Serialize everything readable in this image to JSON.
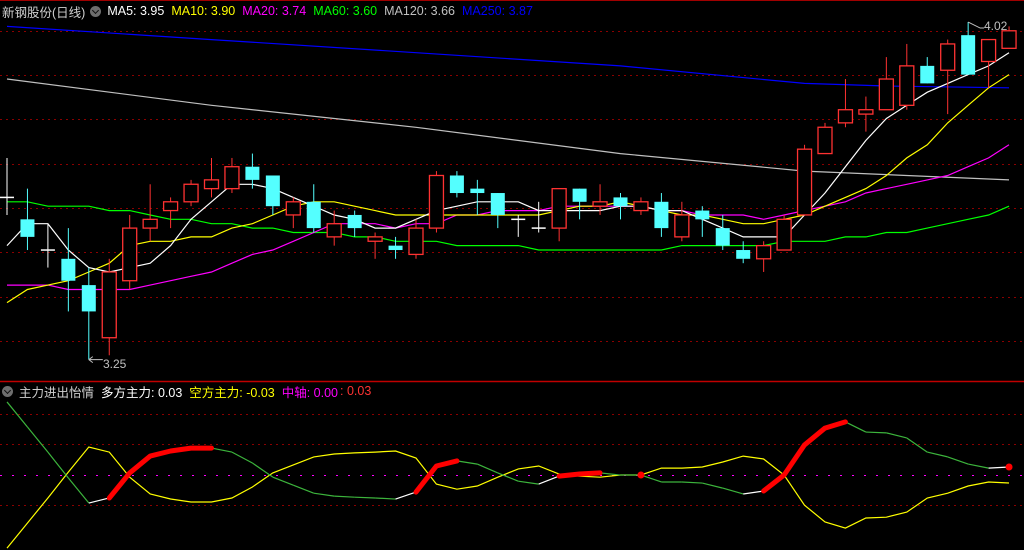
{
  "header": {
    "stock_title": "新钢股份(日线)",
    "ma_labels": [
      {
        "text": "MA5: 3.95",
        "color": "#ffffff"
      },
      {
        "text": "MA10: 3.90",
        "color": "#ffff00"
      },
      {
        "text": "MA20: 3.74",
        "color": "#ff00ff"
      },
      {
        "text": "MA60: 3.60",
        "color": "#00ff00"
      },
      {
        "text": "MA120: 3.66",
        "color": "#c0c0c0"
      },
      {
        "text": "MA250: 3.87",
        "color": "#0000ff"
      }
    ]
  },
  "indicator_header": {
    "name": "主力进出怡情",
    "long_label": "多方主力: 0.03",
    "short_label": "空方主力: -0.03",
    "axis_label": "中轴: 0.00",
    "extra_label": ": 0.03"
  },
  "annotations": {
    "high": "4.02",
    "low": "3.25",
    "high_index": 47,
    "low_index": 4
  },
  "colors": {
    "up": "#ff3232",
    "down": "#54ffff",
    "doji": "#ffffff",
    "grid": "#8b0000",
    "long": "#3cb43c",
    "long_up": "#ffffff",
    "short": "#ffff00",
    "highlight": "#ff0000",
    "axis": "#ff00ff"
  },
  "chart_data": [
    {
      "type": "candlestick",
      "title": "新钢股份(日线)",
      "ylim": [
        3.215,
        4.036
      ],
      "ohlc": [
        [
          3.62,
          3.71,
          3.58,
          3.62
        ],
        [
          3.57,
          3.64,
          3.5,
          3.53
        ],
        [
          3.5,
          3.56,
          3.46,
          3.5
        ],
        [
          3.48,
          3.55,
          3.36,
          3.43
        ],
        [
          3.42,
          3.46,
          3.25,
          3.36
        ],
        [
          3.3,
          3.48,
          3.26,
          3.45
        ],
        [
          3.43,
          3.58,
          3.41,
          3.55
        ],
        [
          3.55,
          3.65,
          3.52,
          3.57
        ],
        [
          3.59,
          3.62,
          3.55,
          3.61
        ],
        [
          3.61,
          3.66,
          3.6,
          3.65
        ],
        [
          3.64,
          3.71,
          3.62,
          3.66
        ],
        [
          3.64,
          3.71,
          3.63,
          3.69
        ],
        [
          3.69,
          3.72,
          3.64,
          3.66
        ],
        [
          3.67,
          3.67,
          3.58,
          3.6
        ],
        [
          3.58,
          3.62,
          3.55,
          3.61
        ],
        [
          3.61,
          3.65,
          3.54,
          3.55
        ],
        [
          3.53,
          3.59,
          3.51,
          3.56
        ],
        [
          3.58,
          3.59,
          3.53,
          3.55
        ],
        [
          3.52,
          3.54,
          3.48,
          3.53
        ],
        [
          3.51,
          3.53,
          3.48,
          3.5
        ],
        [
          3.49,
          3.57,
          3.48,
          3.55
        ],
        [
          3.55,
          3.68,
          3.54,
          3.67
        ],
        [
          3.67,
          3.68,
          3.62,
          3.63
        ],
        [
          3.64,
          3.66,
          3.58,
          3.63
        ],
        [
          3.63,
          3.63,
          3.55,
          3.58
        ],
        [
          3.57,
          3.58,
          3.53,
          3.57
        ],
        [
          3.55,
          3.61,
          3.54,
          3.55
        ],
        [
          3.55,
          3.64,
          3.52,
          3.64
        ],
        [
          3.64,
          3.64,
          3.57,
          3.61
        ],
        [
          3.6,
          3.65,
          3.58,
          3.61
        ],
        [
          3.62,
          3.63,
          3.57,
          3.6
        ],
        [
          3.59,
          3.62,
          3.58,
          3.61
        ],
        [
          3.61,
          3.63,
          3.53,
          3.55
        ],
        [
          3.53,
          3.61,
          3.52,
          3.58
        ],
        [
          3.59,
          3.6,
          3.53,
          3.57
        ],
        [
          3.55,
          3.58,
          3.5,
          3.51
        ],
        [
          3.5,
          3.52,
          3.47,
          3.48
        ],
        [
          3.48,
          3.52,
          3.45,
          3.51
        ],
        [
          3.5,
          3.58,
          3.5,
          3.57
        ],
        [
          3.58,
          3.74,
          3.58,
          3.73
        ],
        [
          3.72,
          3.79,
          3.72,
          3.78
        ],
        [
          3.79,
          3.89,
          3.78,
          3.82
        ],
        [
          3.81,
          3.85,
          3.77,
          3.82
        ],
        [
          3.82,
          3.94,
          3.82,
          3.89
        ],
        [
          3.83,
          3.97,
          3.82,
          3.92
        ],
        [
          3.92,
          3.94,
          3.88,
          3.88
        ],
        [
          3.91,
          3.98,
          3.81,
          3.97
        ],
        [
          3.99,
          4.02,
          3.9,
          3.9
        ],
        [
          3.93,
          3.98,
          3.87,
          3.98
        ],
        [
          3.96,
          4.01,
          3.96,
          4.0
        ]
      ],
      "series": [
        {
          "name": "MA250",
          "color": "#0000ff",
          "points": [
            [
              0,
              4.01
            ],
            [
              10,
              3.98
            ],
            [
              20,
              3.95
            ],
            [
              30,
              3.92
            ],
            [
              39,
              3.88
            ],
            [
              43,
              3.874
            ],
            [
              49,
              3.87
            ]
          ]
        },
        {
          "name": "MA120",
          "color": "#c0c0c0",
          "points": [
            [
              0,
              3.89
            ],
            [
              10,
              3.83
            ],
            [
              20,
              3.78
            ],
            [
              30,
              3.72
            ],
            [
              39,
              3.68
            ],
            [
              49,
              3.66
            ]
          ]
        },
        {
          "name": "MA60",
          "color": "#00ff00",
          "values": [
            3.61,
            3.61,
            3.6,
            3.6,
            3.6,
            3.59,
            3.59,
            3.58,
            3.57,
            3.57,
            3.56,
            3.56,
            3.55,
            3.55,
            3.54,
            3.54,
            3.54,
            3.53,
            3.53,
            3.52,
            3.52,
            3.52,
            3.51,
            3.51,
            3.51,
            3.51,
            3.5,
            3.5,
            3.5,
            3.5,
            3.5,
            3.5,
            3.5,
            3.51,
            3.51,
            3.51,
            3.51,
            3.51,
            3.52,
            3.52,
            3.52,
            3.53,
            3.53,
            3.54,
            3.54,
            3.55,
            3.56,
            3.57,
            3.58,
            3.6
          ]
        },
        {
          "name": "MA20",
          "color": "#ff00ff",
          "values": [
            3.42,
            3.42,
            3.42,
            3.41,
            3.41,
            3.41,
            3.41,
            3.42,
            3.43,
            3.44,
            3.45,
            3.47,
            3.49,
            3.5,
            3.52,
            3.54,
            3.56,
            3.56,
            3.56,
            3.55,
            3.56,
            3.56,
            3.58,
            3.58,
            3.59,
            3.59,
            3.59,
            3.6,
            3.6,
            3.6,
            3.6,
            3.6,
            3.59,
            3.59,
            3.58,
            3.58,
            3.58,
            3.57,
            3.58,
            3.59,
            3.6,
            3.61,
            3.63,
            3.64,
            3.65,
            3.66,
            3.67,
            3.69,
            3.71,
            3.74
          ]
        },
        {
          "name": "MA10",
          "color": "#ffff00",
          "values": [
            3.38,
            3.41,
            3.42,
            3.43,
            3.45,
            3.47,
            3.51,
            3.52,
            3.52,
            3.53,
            3.53,
            3.55,
            3.56,
            3.58,
            3.6,
            3.61,
            3.61,
            3.6,
            3.59,
            3.58,
            3.58,
            3.58,
            3.58,
            3.58,
            3.58,
            3.58,
            3.58,
            3.59,
            3.6,
            3.6,
            3.61,
            3.6,
            3.59,
            3.58,
            3.58,
            3.57,
            3.56,
            3.56,
            3.57,
            3.58,
            3.6,
            3.62,
            3.64,
            3.67,
            3.71,
            3.74,
            3.79,
            3.83,
            3.87,
            3.9
          ]
        },
        {
          "name": "MA5",
          "color": "#ffffff",
          "values": [
            3.51,
            3.56,
            3.56,
            3.5,
            3.46,
            3.45,
            3.46,
            3.47,
            3.51,
            3.57,
            3.61,
            3.65,
            3.65,
            3.64,
            3.62,
            3.6,
            3.58,
            3.57,
            3.55,
            3.55,
            3.57,
            3.59,
            3.6,
            3.61,
            3.61,
            3.61,
            3.59,
            3.59,
            3.59,
            3.59,
            3.6,
            3.6,
            3.59,
            3.59,
            3.57,
            3.55,
            3.53,
            3.53,
            3.53,
            3.58,
            3.63,
            3.69,
            3.75,
            3.8,
            3.83,
            3.86,
            3.88,
            3.9,
            3.92,
            3.95
          ]
        }
      ]
    },
    {
      "type": "line",
      "title": "主力进出怡情",
      "ylim": [
        -0.281,
        0.3375
      ],
      "axis_value": 0,
      "series": [
        {
          "name": "多方主力",
          "values": [
            0.274,
            0.18,
            0.086,
            -0.011,
            -0.105,
            -0.086,
            0.008,
            0.071,
            0.09,
            0.101,
            0.101,
            0.086,
            0.045,
            -0.008,
            -0.038,
            -0.068,
            -0.079,
            -0.083,
            -0.086,
            -0.09,
            -0.064,
            0.034,
            0.053,
            0.041,
            0.008,
            -0.023,
            -0.034,
            -0.004,
            0.004,
            0.008,
            0,
            0,
            -0.026,
            -0.026,
            -0.03,
            -0.049,
            -0.071,
            -0.06,
            0,
            0.113,
            0.176,
            0.199,
            0.161,
            0.158,
            0.139,
            0.086,
            0.068,
            0.041,
            0.026,
            0.03
          ]
        },
        {
          "name": "空方主力",
          "values": [
            -0.274,
            -0.18,
            -0.086,
            0.011,
            0.105,
            0.086,
            -0.008,
            -0.071,
            -0.09,
            -0.101,
            -0.101,
            -0.086,
            -0.045,
            0.008,
            0.038,
            0.068,
            0.079,
            0.083,
            0.086,
            0.09,
            0.064,
            -0.034,
            -0.053,
            -0.041,
            -0.008,
            0.023,
            0.034,
            0.004,
            -0.004,
            -0.008,
            0,
            0,
            0.026,
            0.026,
            0.03,
            0.049,
            0.071,
            0.06,
            0,
            -0.113,
            -0.176,
            -0.199,
            -0.161,
            -0.158,
            -0.139,
            -0.086,
            -0.068,
            -0.041,
            -0.026,
            -0.03
          ]
        }
      ],
      "highlight_ranges": [
        [
          5,
          10
        ],
        [
          20,
          22
        ],
        [
          27,
          29
        ],
        [
          31,
          31
        ],
        [
          37,
          41
        ],
        [
          49,
          49
        ]
      ]
    }
  ]
}
